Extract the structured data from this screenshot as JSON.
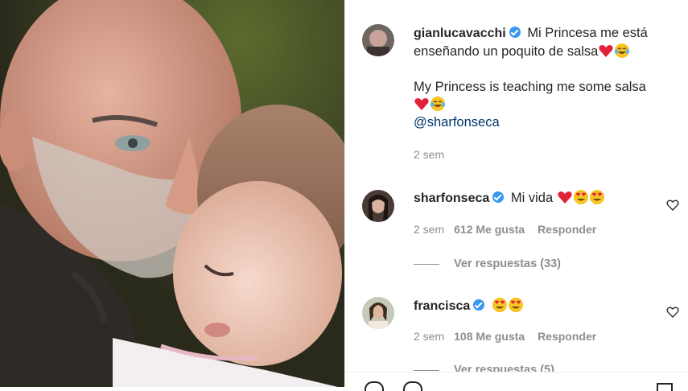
{
  "post": {
    "author": "gianlucavacchi",
    "caption_es": "Mi Princesa me está enseñando un poquito de salsa",
    "caption_en": "My Princess is teaching me some salsa",
    "mention": "@sharfonseca",
    "time": "2 sem"
  },
  "comments": [
    {
      "username": "sharfonseca",
      "text": "Mi vida",
      "time": "2 sem",
      "likes": "612 Me gusta",
      "reply": "Responder",
      "view_replies": "Ver respuestas (33)"
    },
    {
      "username": "francisca",
      "text": "",
      "time": "2 sem",
      "likes": "108 Me gusta",
      "reply": "Responder",
      "view_replies": "Ver respuestas (5)"
    }
  ],
  "icons": {
    "verified": "verified-badge-icon",
    "like": "heart-outline-icon",
    "emoji_heart": "red-heart",
    "emoji_laugh": "face-with-tears-of-joy",
    "emoji_heart_eyes": "smiling-face-with-heart-eyes"
  },
  "colors": {
    "verified": "#3897f0",
    "mention": "#00376b",
    "muted": "#8e8e8e"
  }
}
